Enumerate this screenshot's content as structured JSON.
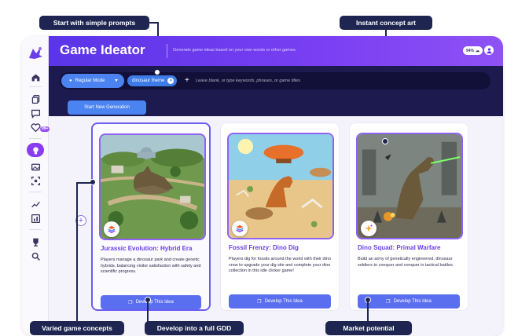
{
  "app": {
    "title": "Game Ideator",
    "subtitle": "Generate game ideas based on your own words or other games.",
    "credits": "94%"
  },
  "search": {
    "mode_label": "Regular Mode",
    "chip_label": "dinosaur theme",
    "placeholder": "Leave blank, or type keywords, phrases, or game titles",
    "generate_label": "Start New Generation"
  },
  "sidebar": {
    "badge": "99+",
    "icons": [
      "home-icon",
      "copy-icon",
      "chat-icon",
      "heart-icon",
      "lightbulb-icon",
      "image-icon",
      "scan-icon",
      "trend-icon",
      "chart-icon",
      "trophy-icon",
      "search-icon"
    ]
  },
  "cards": [
    {
      "title": "Jurassic Evolution: Hybrid Era",
      "description": "Players manage a dinosaur park and create genetic hybrids, balancing visitor satisfaction with safety and scientific progress.",
      "button": "Develop This Idea"
    },
    {
      "title": "Fossil Frenzy: Dino Dig",
      "description": "Players dig for fossils around the world with their dino crew to upgrade your dig site and complete your dino collection in this idle clicker game!",
      "button": "Develop This Idea"
    },
    {
      "title": "Dino Squad: Primal Warfare",
      "description": "Build an army of genetically engineered, dinosaur soldiers to conquer and conquer in tactical battles.",
      "button": "Develop This Idea"
    }
  ],
  "callouts": {
    "prompts": "Start with simple prompts",
    "concept_art": "Instant concept art",
    "varied": "Varied game concepts",
    "gdd": "Develop into a full GDD",
    "market": "Market potential"
  },
  "colors": {
    "header_start": "#5a35e8",
    "header_end": "#8e52f5",
    "search_bg": "#1c1a4e",
    "accent_blue": "#4b83f0",
    "title_purple": "#6a40e8",
    "callout_navy": "#1e2550"
  }
}
